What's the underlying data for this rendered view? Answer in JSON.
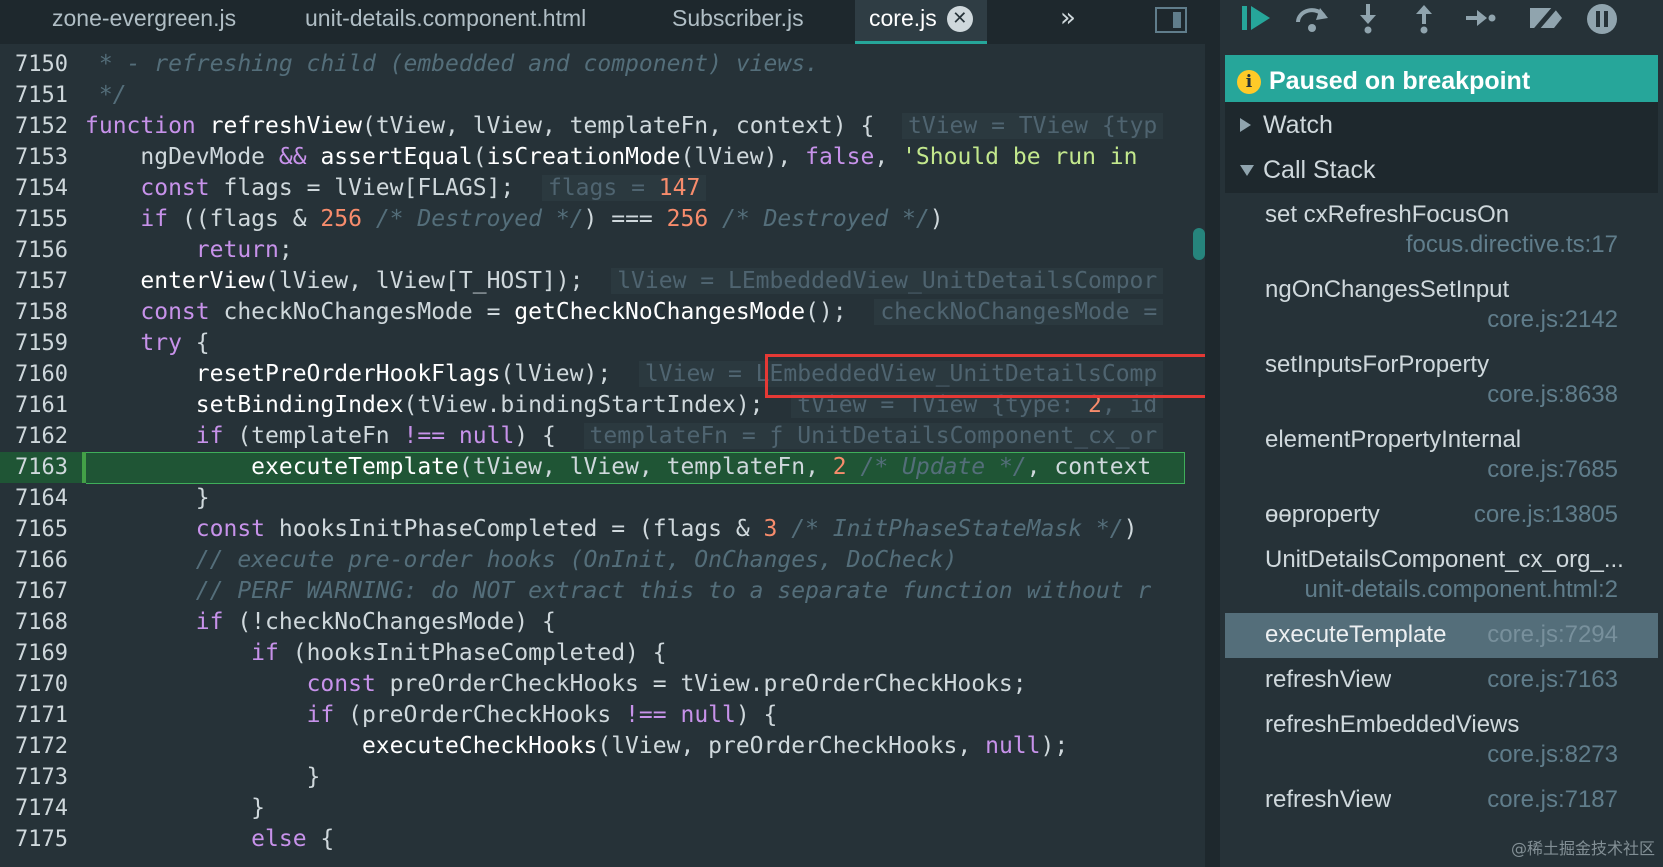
{
  "tabs": [
    {
      "label": "zone-evergreen.js",
      "active": false
    },
    {
      "label": "unit-details.component.html",
      "active": false
    },
    {
      "label": "Subscriber.js",
      "active": false
    },
    {
      "label": "core.js",
      "active": true
    }
  ],
  "icons": {
    "tab_close": "✕",
    "tab_more": "»",
    "info": "i"
  },
  "code": {
    "lines": [
      {
        "n": "7150",
        "html": "<span class=\"cmt\"> * - refreshing child (embedded and component) views.</span>"
      },
      {
        "n": "7151",
        "html": "<span class=\"cmt\"> */</span>"
      },
      {
        "n": "7152",
        "html": "<span class=\"kw\">function</span> <span class=\"fn\">refreshView</span>(tView, lView, templateFn, context) {  <span class=\"inline\">tView = TView {typ</span>"
      },
      {
        "n": "7153",
        "html": "    ngDevMode <span class=\"kw\">&amp;&amp;</span> <span class=\"fn\">assertEqual</span>(<span class=\"fn\">isCreationMode</span>(lView), <span class=\"kw\">false</span>, <span class=\"str\">'Should be run in</span>"
      },
      {
        "n": "7154",
        "html": "    <span class=\"kw\">const</span> flags = lView[FLAGS];  <span class=\"inline\">flags = <span class=\"num\">147</span></span>"
      },
      {
        "n": "7155",
        "html": "    <span class=\"kw\">if</span> ((flags &amp; <span class=\"num\">256</span> <span class=\"cmt\">/* Destroyed */</span>) === <span class=\"num\">256</span> <span class=\"cmt\">/* Destroyed */</span>)"
      },
      {
        "n": "7156",
        "html": "        <span class=\"kw\">return</span>;"
      },
      {
        "n": "7157",
        "html": "    <span class=\"fn\">enterView</span>(lView, lView[T_HOST]);  <span class=\"inline\">lView = LEmbeddedView_UnitDetailsCompor</span>"
      },
      {
        "n": "7158",
        "html": "    <span class=\"kw\">const</span> checkNoChangesMode = <span class=\"fn\">getCheckNoChangesMode</span>();  <span class=\"inline\">checkNoChangesMode =</span>"
      },
      {
        "n": "7159",
        "html": "    <span class=\"kw\">try</span> {"
      },
      {
        "n": "7160",
        "html": "        <span class=\"fn\">resetPreOrderHookFlags</span>(lView);  <span class=\"inline\">lView = LEmbeddedView_UnitDetailsComp</span>"
      },
      {
        "n": "7161",
        "html": "        <span class=\"fn\">setBindingIndex</span>(tView.bindingStartIndex);  <span class=\"inline\">tView = TView {type: <span class=\"num\">2</span>, id</span>"
      },
      {
        "n": "7162",
        "html": "        <span class=\"kw\">if</span> (templateFn <span class=\"kw\">!==</span> <span class=\"kw\">null</span>) {  <span class=\"inline\">templateFn = ƒ UnitDetailsComponent_cx_or</span>"
      },
      {
        "n": "7163",
        "html": "            <span class=\"fn\">executeTemplate</span>(tView, lView, templateFn, <span class=\"num\">2</span> <span class=\"cmt\">/* Update */</span>, context",
        "exec": true
      },
      {
        "n": "7164",
        "html": "        }"
      },
      {
        "n": "7165",
        "html": "        <span class=\"kw\">const</span> hooksInitPhaseCompleted = (flags &amp; <span class=\"num\">3</span> <span class=\"cmt\">/* InitPhaseStateMask */</span>)"
      },
      {
        "n": "7166",
        "html": "        <span class=\"cmt\">// execute pre-order hooks (OnInit, OnChanges, DoCheck)</span>"
      },
      {
        "n": "7167",
        "html": "        <span class=\"cmt\">// PERF WARNING: do NOT extract this to a separate function without r</span>"
      },
      {
        "n": "7168",
        "html": "        <span class=\"kw\">if</span> (!checkNoChangesMode) {"
      },
      {
        "n": "7169",
        "html": "            <span class=\"kw\">if</span> (hooksInitPhaseCompleted) {"
      },
      {
        "n": "7170",
        "html": "                <span class=\"kw\">const</span> preOrderCheckHooks = tView.preOrderCheckHooks;"
      },
      {
        "n": "7171",
        "html": "                <span class=\"kw\">if</span> (preOrderCheckHooks <span class=\"kw\">!==</span> <span class=\"kw\">null</span>) {"
      },
      {
        "n": "7172",
        "html": "                    <span class=\"fn\">executeCheckHooks</span>(lView, preOrderCheckHooks, <span class=\"kw\">null</span>);"
      },
      {
        "n": "7173",
        "html": "                }"
      },
      {
        "n": "7174",
        "html": "            }"
      },
      {
        "n": "7175",
        "html": "            <span class=\"kw\">else</span> {"
      }
    ]
  },
  "debugger": {
    "banner": "Paused on breakpoint",
    "watch_label": "Watch",
    "callstack_label": "Call Stack",
    "frames": [
      {
        "name": "set cxRefreshFocusOn",
        "location": "focus.directive.ts:17",
        "two_line": true
      },
      {
        "name": "ngOnChangesSetInput",
        "location": "core.js:2142",
        "two_line": true
      },
      {
        "name": "setInputsForProperty",
        "location": "core.js:8638",
        "two_line": true
      },
      {
        "name": "elementPropertyInternal",
        "location": "core.js:7685",
        "two_line": true
      },
      {
        "name": "ɵɵproperty",
        "location": "core.js:13805",
        "two_line": false
      },
      {
        "name": "UnitDetailsComponent_cx_org_...",
        "location": "unit-details.component.html:2",
        "two_line": true
      },
      {
        "name": "executeTemplate",
        "location": "core.js:7294",
        "two_line": false,
        "selected": true
      },
      {
        "name": "refreshView",
        "location": "core.js:7163",
        "two_line": false
      },
      {
        "name": "refreshEmbeddedViews",
        "location": "core.js:8273",
        "two_line": true
      },
      {
        "name": "refreshView",
        "location": "core.js:7187",
        "two_line": false
      }
    ]
  },
  "watermark": "@稀土掘金技术社区",
  "colors": {
    "accent": "#26a69a",
    "exec_line": "#1f5535",
    "highlight_border": "#e53935"
  }
}
